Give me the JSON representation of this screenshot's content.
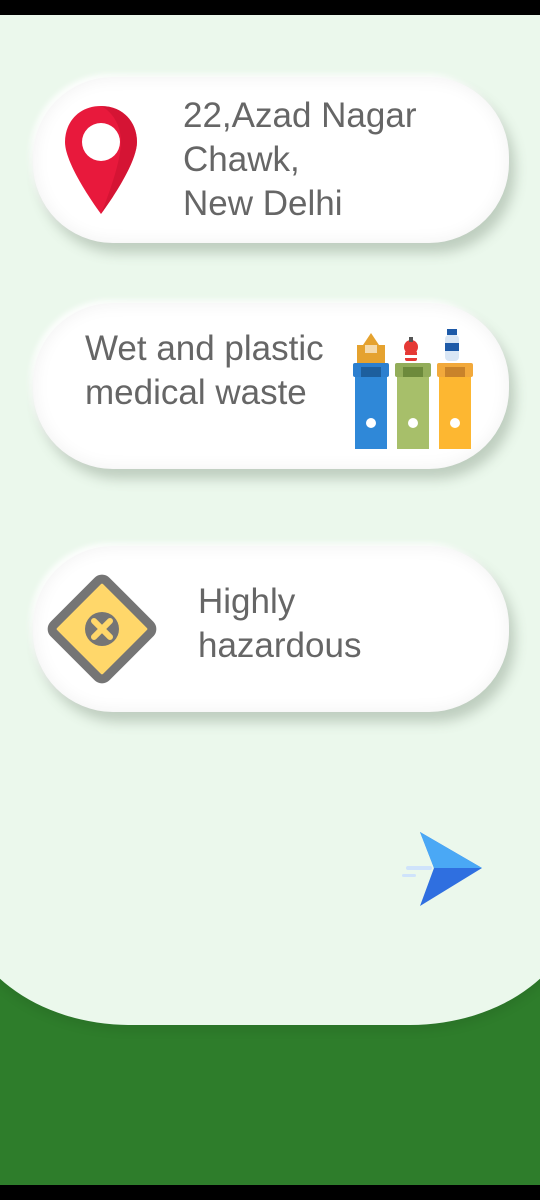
{
  "cards": {
    "location": {
      "lines": [
        "22,Azad Nagar",
        "Chawk,",
        "New Delhi"
      ],
      "icon": "location-pin-icon"
    },
    "waste_type": {
      "lines": [
        "Wet and plastic",
        "medical waste"
      ],
      "icon": "recycle-bins-icon"
    },
    "hazard_level": {
      "lines": [
        "Highly",
        "hazardous"
      ],
      "icon": "hazard-sign-icon"
    }
  },
  "actions": {
    "send_icon": "send-icon"
  },
  "colors": {
    "panel_background": "#ebf8ec",
    "footer_green": "#2e7d2b",
    "card_text": "#666666",
    "pin_red": "#e8193c",
    "send_blue": "#2f6fe0"
  }
}
